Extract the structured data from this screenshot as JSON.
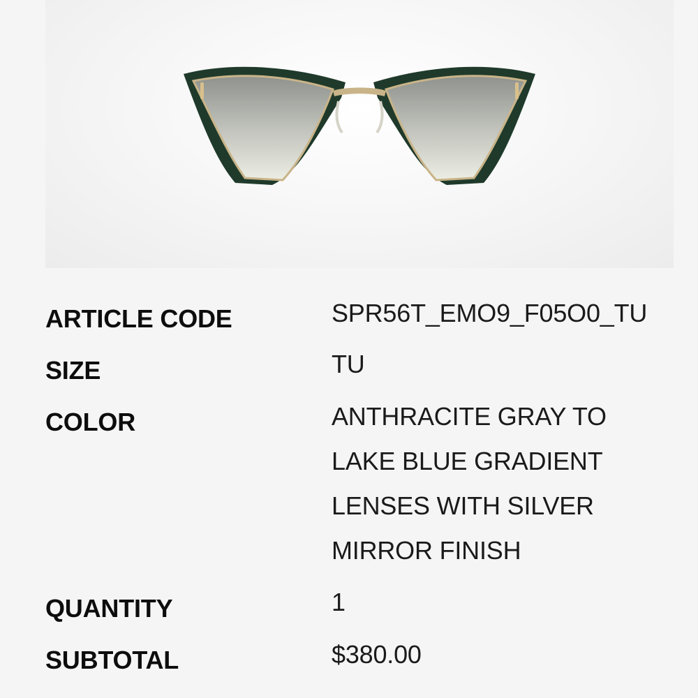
{
  "product": {
    "image_alt": "sunglasses-product-image",
    "colors": {
      "frame": "#203a2c",
      "lens_top": "#9c9f9a",
      "lens_bottom": "#e4e5dc",
      "metal": "#c9b489",
      "temple": "#e9e4d4",
      "background": "#f5f5f5"
    }
  },
  "details": {
    "article_code": {
      "label": "ARTICLE CODE",
      "value": "SPR56T_EMO9_F05O0_TU"
    },
    "size": {
      "label": "SIZE",
      "value": "TU"
    },
    "color": {
      "label": "COLOR",
      "value_lines": [
        "ANTHRACITE GRAY TO",
        "LAKE BLUE GRADIENT",
        "LENSES WITH SILVER",
        "MIRROR FINISH"
      ]
    },
    "quantity": {
      "label": "QUANTITY",
      "value": "1"
    },
    "subtotal": {
      "label": "SUBTOTAL",
      "value": "$380.00"
    }
  }
}
